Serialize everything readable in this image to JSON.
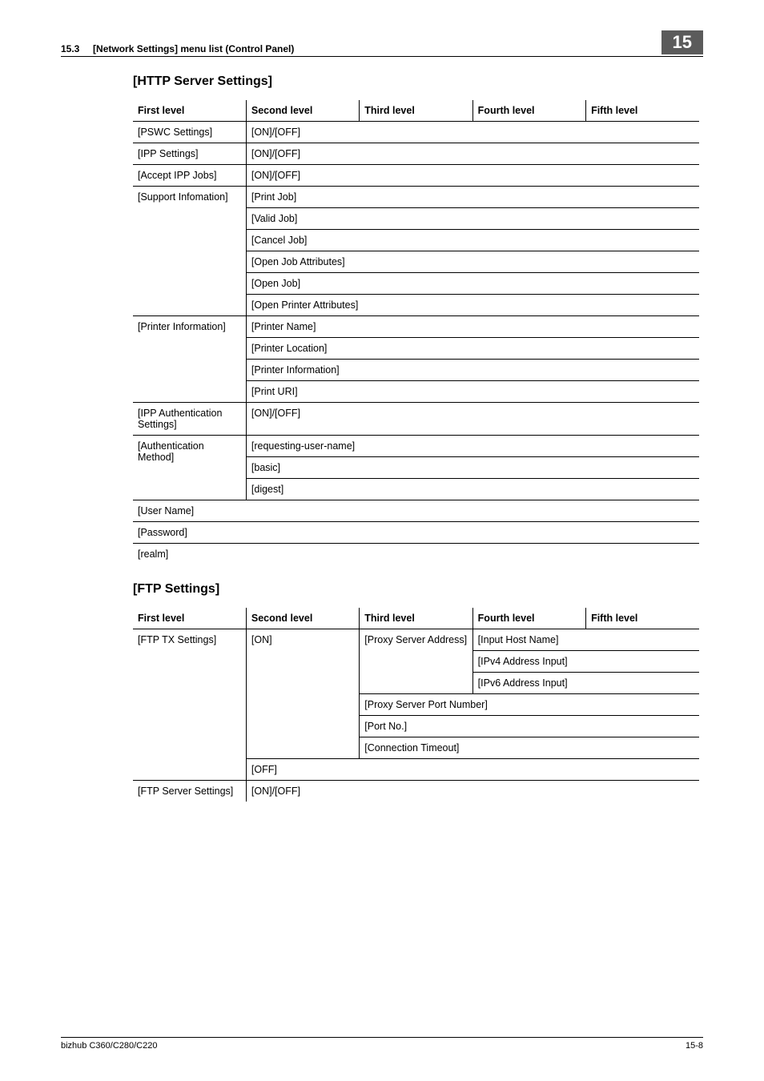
{
  "header": {
    "section_num": "15.3",
    "section_title": "[Network Settings] menu list (Control Panel)",
    "chapter": "15"
  },
  "http": {
    "title": "[HTTP Server Settings]",
    "cols": [
      "First level",
      "Second level",
      "Third level",
      "Fourth level",
      "Fifth level"
    ],
    "r1c1": "[PSWC Settings]",
    "r1c2": "[ON]/[OFF]",
    "r2c1": "[IPP Settings]",
    "r2c2": "[ON]/[OFF]",
    "r3c1": "[Accept IPP Jobs]",
    "r3c2": "[ON]/[OFF]",
    "r4c1": "[Support Infomation]",
    "r4c2": "[Print Job]",
    "r5c2": "[Valid Job]",
    "r6c2": "[Cancel Job]",
    "r7c2": "[Open Job Attributes]",
    "r8c2": "[Open Job]",
    "r9c2": "[Open Printer Attributes]",
    "r10c1": "[Printer Information]",
    "r10c2": "[Printer Name]",
    "r11c2": "[Printer Location]",
    "r12c2": "[Printer Information]",
    "r13c2": "[Print URI]",
    "r14c1": "[IPP Authentication Settings]",
    "r14c2": "[ON]/[OFF]",
    "r15c1": "[Authentication Method]",
    "r15c2": "[requesting-user-name]",
    "r16c2": "[basic]",
    "r17c2": "[digest]",
    "r18c1": "[User Name]",
    "r19c1": "[Password]",
    "r20c1": "[realm]"
  },
  "ftp": {
    "title": "[FTP Settings]",
    "cols": [
      "First level",
      "Second level",
      "Third level",
      "Fourth level",
      "Fifth level"
    ],
    "r1c1": "[FTP TX Settings]",
    "r1c2": "[ON]",
    "r1c3": "[Proxy Server Address]",
    "r1c4": "[Input Host Name]",
    "r2c4": "[IPv4 Address Input]",
    "r3c4": "[IPv6 Address Input]",
    "r4c3": "[Proxy Server Port Number]",
    "r5c3": "[Port No.]",
    "r6c3": "[Connection Timeout]",
    "r7c2": "[OFF]",
    "r8c1": "[FTP Server Settings]",
    "r8c2": "[ON]/[OFF]"
  },
  "footer": {
    "left": "bizhub C360/C280/C220",
    "right": "15-8"
  }
}
